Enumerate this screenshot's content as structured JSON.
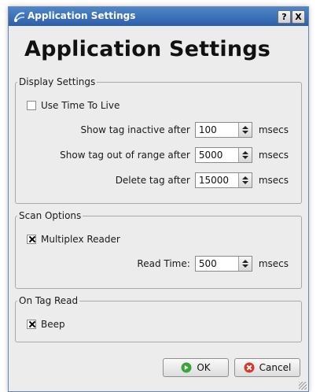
{
  "window": {
    "title": "Application Settings",
    "help_label": "?",
    "close_label": "X"
  },
  "heading": "Application Settings",
  "display_settings": {
    "legend": "Display Settings",
    "use_ttl": {
      "label": "Use Time To Live",
      "checked": false
    },
    "rows": [
      {
        "label": "Show tag inactive after",
        "value": "100",
        "unit": "msecs"
      },
      {
        "label": "Show tag out of range after",
        "value": "5000",
        "unit": "msecs"
      },
      {
        "label": "Delete tag after",
        "value": "15000",
        "unit": "msecs"
      }
    ]
  },
  "scan_options": {
    "legend": "Scan Options",
    "multiplex": {
      "label": "Multiplex Reader",
      "checked": true
    },
    "read_time": {
      "label": "Read Time:",
      "value": "500",
      "unit": "msecs"
    }
  },
  "on_tag_read": {
    "legend": "On Tag Read",
    "beep": {
      "label": "Beep",
      "checked": true
    }
  },
  "buttons": {
    "ok": {
      "label": "OK",
      "icon": "ok-check-icon",
      "color": "#3aa53a"
    },
    "cancel": {
      "label": "Cancel",
      "icon": "cancel-x-icon",
      "color": "#d03a2f"
    }
  }
}
